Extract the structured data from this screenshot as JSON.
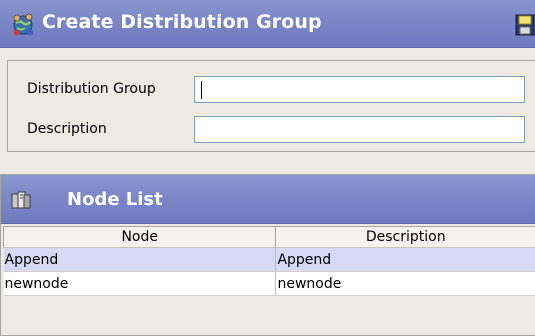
{
  "window": {
    "title": "Create Distribution Group",
    "icon": "globe-people-icon",
    "save_icon": "save-icon"
  },
  "form": {
    "distribution_group_label": "Distribution Group",
    "distribution_group_value": "",
    "description_label": "Description",
    "description_value": ""
  },
  "node_list": {
    "title": "Node List",
    "icon": "node-list-icon",
    "columns": [
      "Node",
      "Description"
    ],
    "rows": [
      {
        "node": "Append",
        "description": "Append",
        "selected": true
      },
      {
        "node": "newnode",
        "description": "newnode",
        "selected": false
      }
    ]
  },
  "colors": {
    "header_gradient_top": "#8b95ce",
    "header_gradient_bottom": "#6d7abf",
    "selected_row": "#d6d9f4",
    "background": "#eceae3"
  }
}
